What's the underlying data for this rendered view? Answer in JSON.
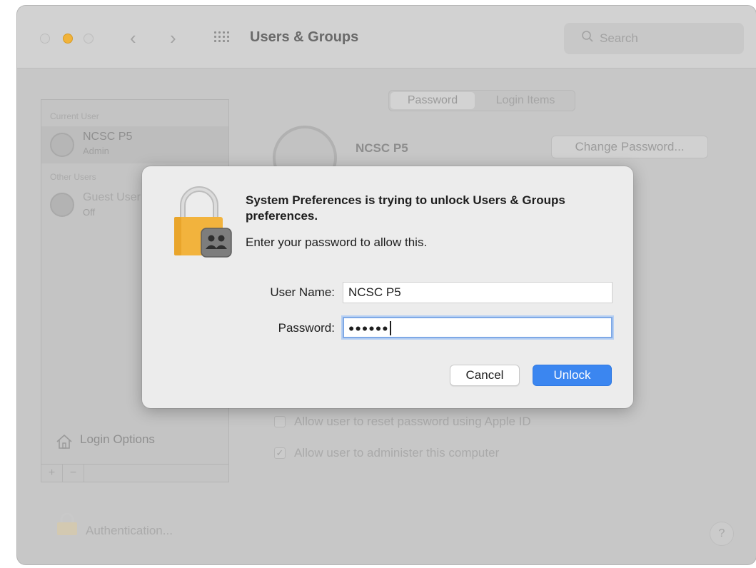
{
  "window": {
    "title": "Users & Groups",
    "search_placeholder": "Search"
  },
  "sidebar": {
    "current_users_header": "Current User",
    "current_user": {
      "name": "NCSC P5",
      "role": "Admin"
    },
    "other_users_header": "Other Users",
    "guest_user": {
      "name": "Guest User",
      "status": "Off"
    },
    "login_options_label": "Login Options",
    "add_label": "+",
    "remove_label": "−"
  },
  "main": {
    "tabs": [
      "Password",
      "Login Items"
    ],
    "user_name": "NCSC P5",
    "change_password_label": "Change Password...",
    "option_reset_password": "Allow user to reset password using Apple ID",
    "option_administer": "Allow user to administer this computer",
    "option_administer_checked": true,
    "auth_label": "Authentication..."
  },
  "help_label": "?",
  "dialog": {
    "title": "System Preferences is trying to unlock Users & Groups preferences.",
    "message": "Enter your password to allow this.",
    "username_label": "User Name:",
    "username_value": "NCSC P5",
    "password_label": "Password:",
    "password_mask": "●●●●●●",
    "cancel_label": "Cancel",
    "unlock_label": "Unlock"
  },
  "colors": {
    "accent": "#3b86f0",
    "lock_gold": "#f2b33d",
    "traffic_yellow": "#f1b33a"
  },
  "icons": [
    "back-icon",
    "forward-icon",
    "grid-icon",
    "search-icon",
    "lock-icon",
    "users-badge-icon",
    "house-icon",
    "help-icon"
  ]
}
